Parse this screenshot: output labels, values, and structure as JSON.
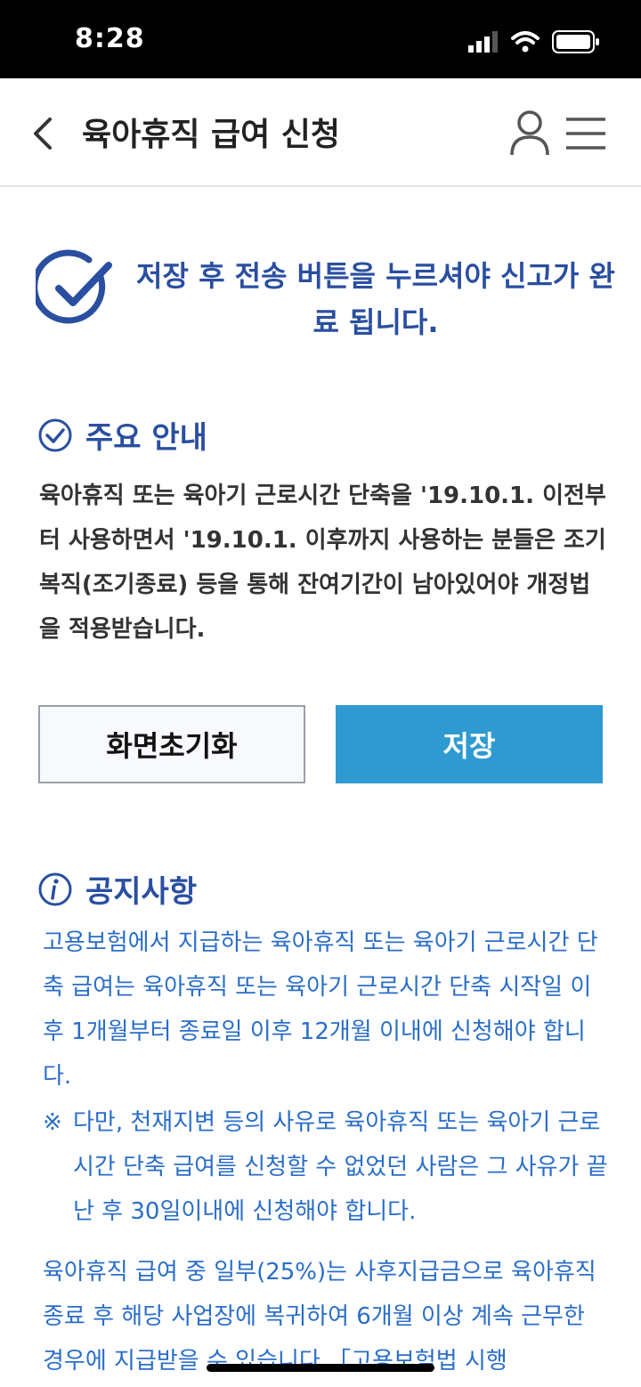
{
  "status": {
    "time": "8:28"
  },
  "header": {
    "title": "육아휴직 급여 신청"
  },
  "banner": {
    "message": "저장 후 전송 버튼을 누르셔야 신고가 완료 됩니다."
  },
  "guide": {
    "heading": "주요 안내",
    "body": "육아휴직 또는 육아기 근로시간 단축을 '19.10.1. 이전부터 사용하면서 '19.10.1. 이후까지 사용하는 분들은 조기복직(조기종료) 등을 통해 잔여기간이 남아있어야 개정법을 적용받습니다."
  },
  "buttons": {
    "reset": "화면초기화",
    "save": "저장"
  },
  "notice": {
    "heading": "공지사항",
    "para1": "고용보험에서 지급하는 육아휴직 또는 육아기 근로시간 단축 급여는 육아휴직 또는 육아기 근로시간 단축 시작일 이후 1개월부터 종료일 이후 12개월 이내에 신청해야 합니다.",
    "note_mark": "※",
    "note": "다만, 천재지변 등의 사유로 육아휴직 또는 육아기 근로시간 단축 급여를 신청할 수 없었던 사람은 그 사유가 끝난 후 30일이내에 신청해야 합니다.",
    "para2": "육아휴직 급여 중 일부(25%)는 사후지급금으로 육아휴직 종료 후 해당 사업장에 복귀하여 6개월 이상 계속 근무한 경우에 지급받을 수 있습니다.「고용보험법 시행"
  },
  "colors": {
    "brand": "#2a4fa0",
    "link": "#2a6ec8",
    "save": "#2f9ad1"
  }
}
